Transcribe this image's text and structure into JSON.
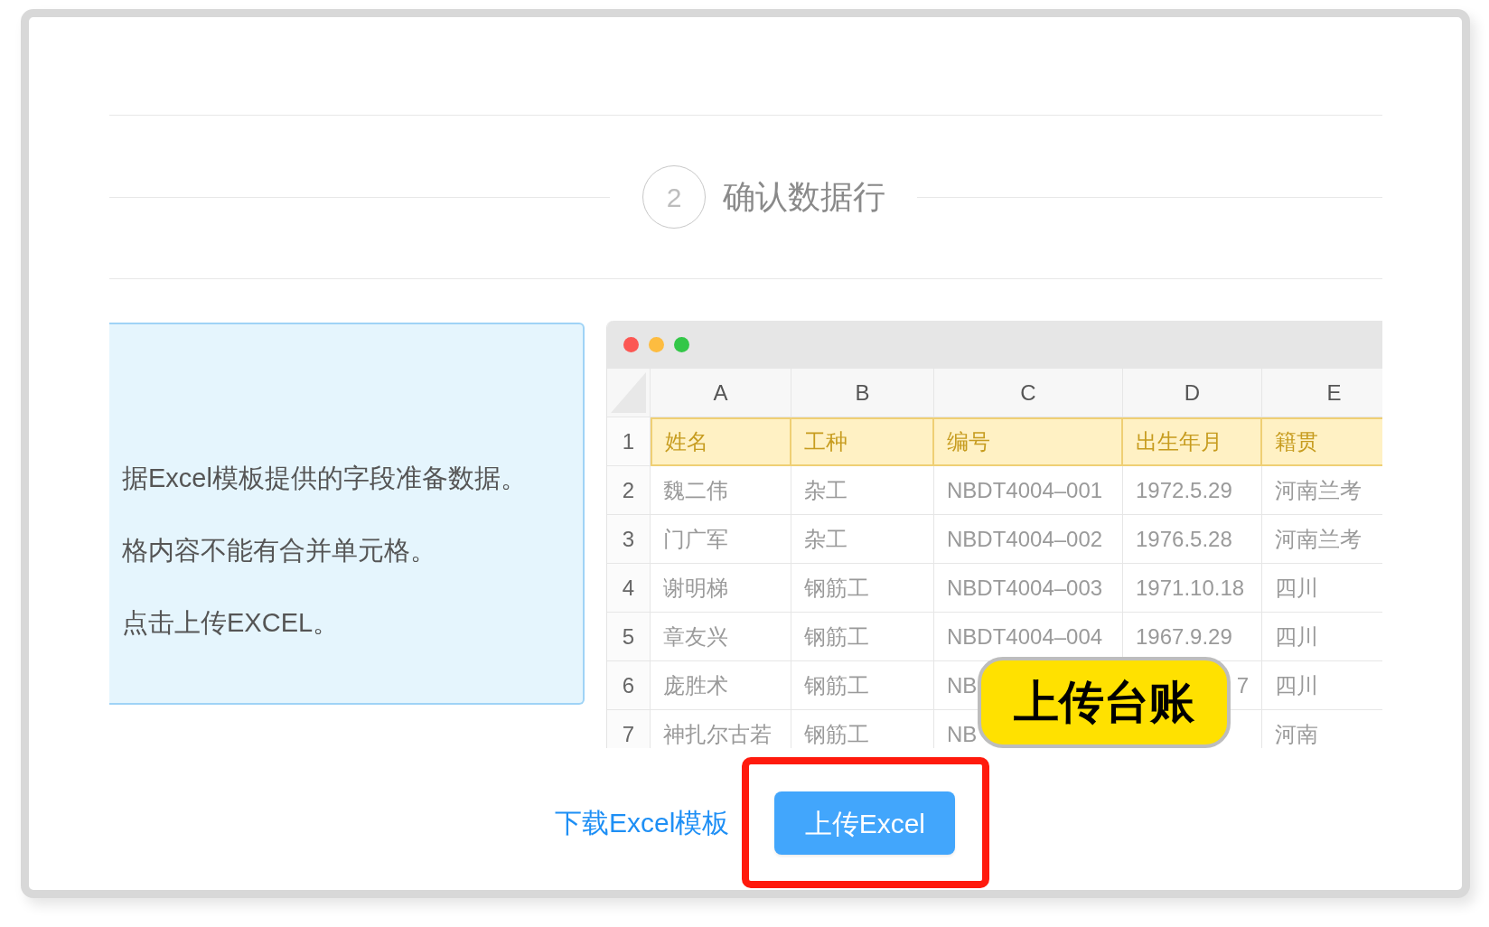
{
  "step": {
    "number": "2",
    "label": "确认数据行"
  },
  "instructions": [
    "据Excel模板提供的字段准备数据。",
    "格内容不能有合并单元格。",
    "点击上传EXCEL。"
  ],
  "spreadsheet": {
    "columns": [
      "A",
      "B",
      "C",
      "D",
      "E"
    ],
    "rows": [
      {
        "number": "1",
        "kind": "header",
        "cells": [
          "姓名",
          "工种",
          "编号",
          "出生年月",
          "籍贯"
        ]
      },
      {
        "number": "2",
        "kind": "data",
        "cells": [
          "魏二伟",
          "杂工",
          "NBDT4004–001",
          "1972.5.29",
          "河南兰考"
        ]
      },
      {
        "number": "3",
        "kind": "data",
        "cells": [
          "门广军",
          "杂工",
          "NBDT4004–002",
          "1976.5.28",
          "河南兰考"
        ]
      },
      {
        "number": "4",
        "kind": "data",
        "cells": [
          "谢明梯",
          "钢筋工",
          "NBDT4004–003",
          "1971.10.18",
          "四川"
        ]
      },
      {
        "number": "5",
        "kind": "data",
        "cells": [
          "章友兴",
          "钢筋工",
          "NBDT4004–004",
          "1967.9.29",
          "四川"
        ]
      },
      {
        "number": "6",
        "kind": "data",
        "cells": [
          "庞胜术",
          "钢筋工",
          "NB",
          {
            "text": "7",
            "kind": "tail"
          },
          "四川"
        ]
      },
      {
        "number": "7",
        "kind": "data",
        "cells": [
          "神扎尔古若",
          "钢筋工",
          "NB",
          null,
          "河南"
        ]
      }
    ]
  },
  "callout": {
    "label": "上传台账"
  },
  "actions": {
    "download_link": {
      "label": "下载Excel模板"
    },
    "upload_button": {
      "label": "上传Excel",
      "highlighted": true
    }
  }
}
